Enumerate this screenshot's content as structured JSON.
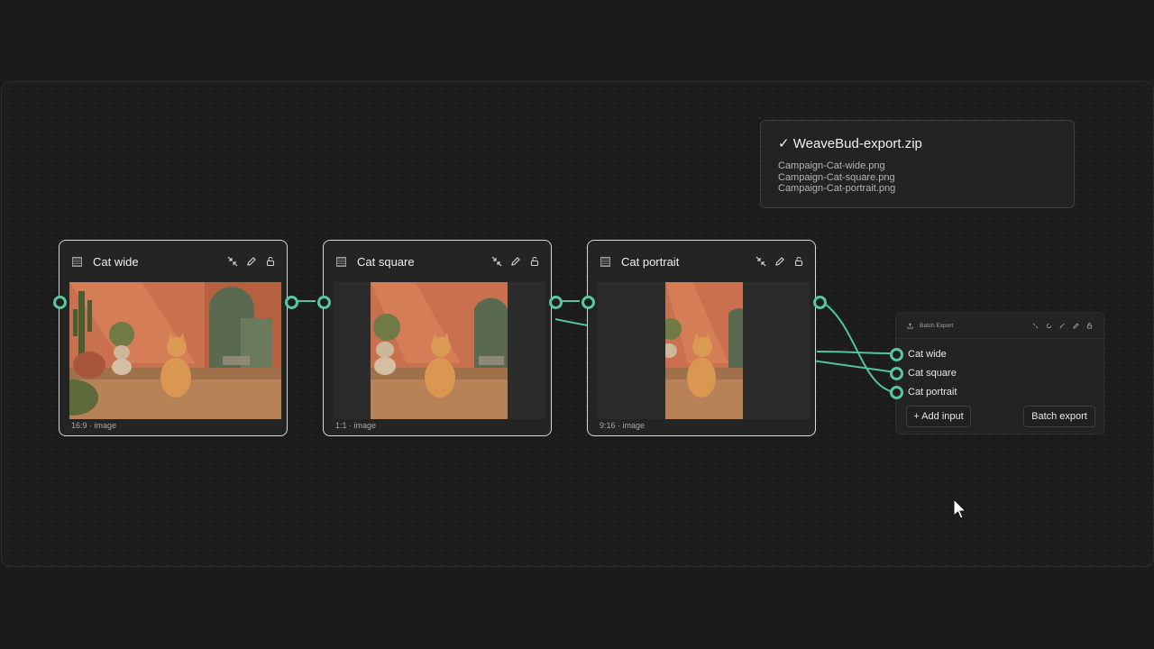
{
  "nodes": [
    {
      "title": "Cat wide",
      "meta": "16:9 · image"
    },
    {
      "title": "Cat square",
      "meta": "1:1 · image"
    },
    {
      "title": "Cat portrait",
      "meta": "9:16 · image"
    }
  ],
  "toast": {
    "title": "✓ WeaveBud-export.zip",
    "files": [
      "Campaign-Cat-wide.png",
      "Campaign-Cat-square.png",
      "Campaign-Cat-portrait.png"
    ]
  },
  "batch": {
    "title": "Batch Export",
    "inputs": [
      "Cat wide",
      "Cat square",
      "Cat portrait"
    ],
    "add_input_label": "+ Add input",
    "export_label": "Batch export"
  },
  "colors": {
    "accent": "#58c79f",
    "background": "#1b1b1b",
    "node": "#242424"
  },
  "icons": [
    "image-node-icon",
    "shrink-icon",
    "pencil-icon",
    "unlock-icon",
    "export-icon"
  ]
}
